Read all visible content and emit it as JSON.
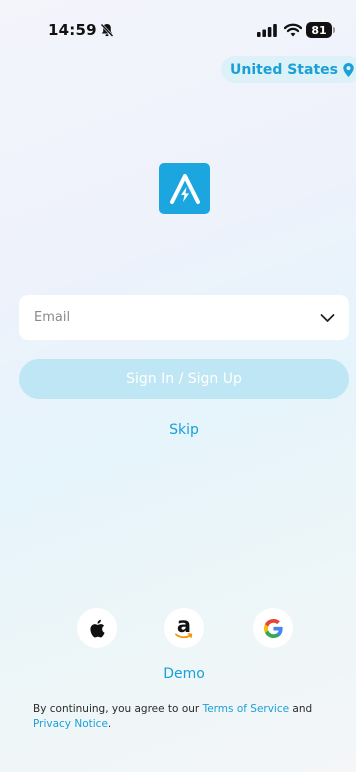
{
  "status_bar": {
    "time": "14:59",
    "battery": "81"
  },
  "region": {
    "label": "United States"
  },
  "login": {
    "email_placeholder": "Email",
    "signin_label": "Sign In / Sign Up",
    "skip_label": "Skip"
  },
  "social": {
    "apple_icon": "apple-icon",
    "amazon_letter": "a",
    "google_icon": "google-icon"
  },
  "demo_label": "Demo",
  "legal": {
    "prefix": "By continuing, you agree to our ",
    "terms": "Terms of Service",
    "and": " and",
    "privacy": "Privacy Notice",
    "suffix": "."
  },
  "colors": {
    "accent": "#1aa0d8",
    "logo_bg": "#1ba6e0",
    "button_disabled": "#bfe6f4"
  }
}
